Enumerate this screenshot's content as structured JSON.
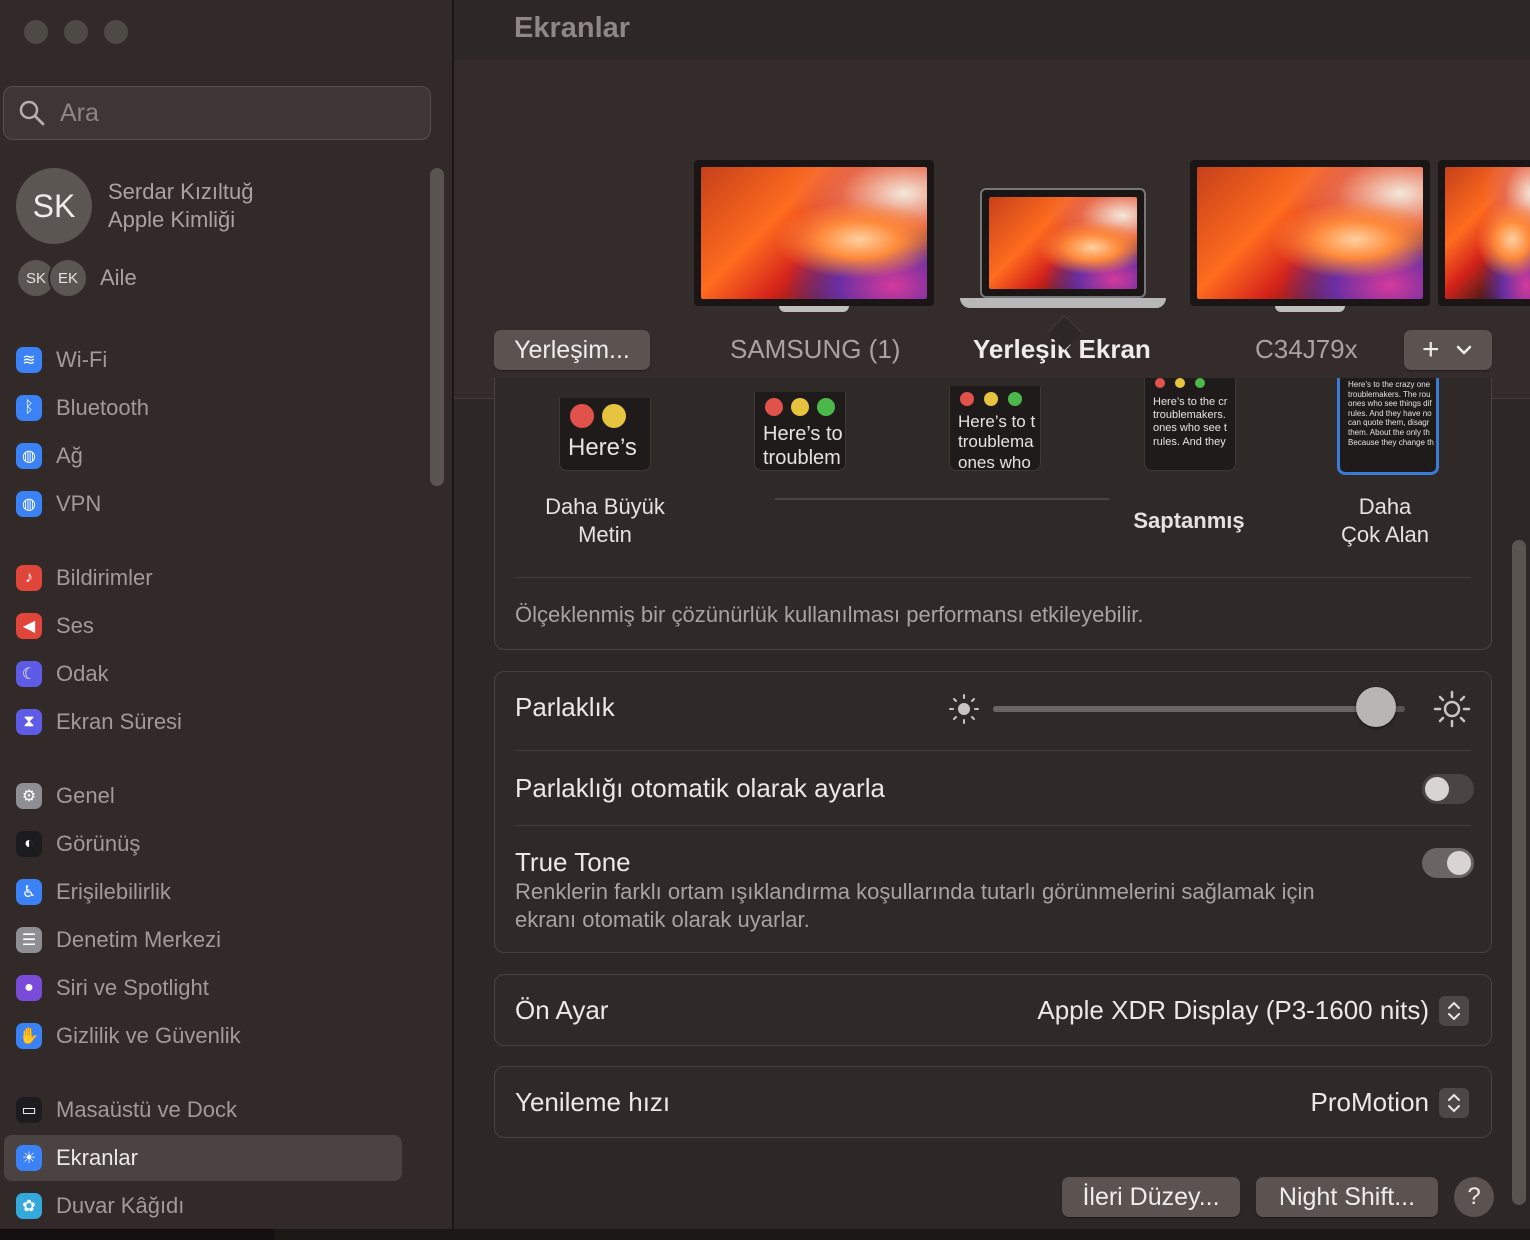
{
  "sidebar": {
    "search_placeholder": "Ara",
    "profile": {
      "initials": "SK",
      "name": "Serdar Kızıltuğ",
      "subtitle": "Apple Kimliği"
    },
    "family": {
      "members": [
        "SK",
        "EK"
      ],
      "label": "Aile"
    },
    "items": [
      {
        "label": "Wi-Fi",
        "icon": "wifi-icon",
        "color": "#3b82f6"
      },
      {
        "label": "Bluetooth",
        "icon": "bluetooth-icon",
        "color": "#3b82f6"
      },
      {
        "label": "Ağ",
        "icon": "globe-icon",
        "color": "#3b82f6"
      },
      {
        "label": "VPN",
        "icon": "vpn-globe-icon",
        "color": "#3b82f6"
      },
      {
        "label": "Bildirimler",
        "icon": "bell-icon",
        "color": "#e0453a"
      },
      {
        "label": "Ses",
        "icon": "speaker-icon",
        "color": "#e0453a"
      },
      {
        "label": "Odak",
        "icon": "moon-icon",
        "color": "#5e5ce6"
      },
      {
        "label": "Ekran Süresi",
        "icon": "hourglass-icon",
        "color": "#5e5ce6"
      },
      {
        "label": "Genel",
        "icon": "gear-icon",
        "color": "#8e8e93"
      },
      {
        "label": "Görünüş",
        "icon": "appearance-icon",
        "color": "#1c1c1e"
      },
      {
        "label": "Erişilebilirlik",
        "icon": "accessibility-icon",
        "color": "#3b82f6"
      },
      {
        "label": "Denetim Merkezi",
        "icon": "control-center-icon",
        "color": "#8e8e93"
      },
      {
        "label": "Siri ve Spotlight",
        "icon": "siri-icon",
        "color": "#7a4ad8"
      },
      {
        "label": "Gizlilik ve Güvenlik",
        "icon": "hand-icon",
        "color": "#3b82f6"
      },
      {
        "label": "Masaüstü ve Dock",
        "icon": "dock-icon",
        "color": "#1c1c1e"
      },
      {
        "label": "Ekranlar",
        "icon": "brightness-icon",
        "color": "#3b82f6",
        "active": true
      },
      {
        "label": "Duvar Kâğıdı",
        "icon": "wallpaper-icon",
        "color": "#34aadc"
      }
    ]
  },
  "main": {
    "title": "Ekranlar",
    "arrangement_button": "Yerleşim...",
    "displays": [
      {
        "label": "SAMSUNG (1)",
        "selected": false
      },
      {
        "label": "Yerleşik Ekran",
        "selected": true
      },
      {
        "label": "C34J79x",
        "selected": false
      }
    ],
    "add_button": "+",
    "resolution": {
      "thumbs": [
        {
          "text": "Here’s",
          "text2": ""
        },
        {
          "text": "Here’s to",
          "text2": "troublem"
        },
        {
          "text": "Here’s to t",
          "text2": "troublema",
          "text3": "ones who"
        },
        {
          "text": "Here’s to the cr",
          "text2": "troublemakers.",
          "text3": "ones who see t",
          "text4": "rules. And they"
        },
        {
          "text": "Here’s to the crazy one",
          "text2": "troublemakers. The rou",
          "text3": "ones who see things dif",
          "text4": "rules. And they have no",
          "text5": "can quote them, disagr",
          "text6": "them. About the only th",
          "text7": "Because they change th"
        }
      ],
      "label_larger": "Daha Büyük Metin",
      "label_larger_1": "Daha Büyük",
      "label_larger_2": "Metin",
      "label_default": "Saptanmış",
      "label_more_1": "Daha",
      "label_more_2": "Çok Alan",
      "note": "Ölçeklenmiş bir çözünürlük kullanılması performansı etkileyebilir."
    },
    "brightness": {
      "label": "Parlaklık",
      "value": 0.93,
      "auto_label": "Parlaklığı otomatik olarak ayarla",
      "auto_on": false,
      "true_tone_label": "True Tone",
      "true_tone_desc_1": "Renklerin farklı ortam ışıklandırma koşullarında tutarlı görünmelerini sağlamak için",
      "true_tone_desc_2": "ekranı otomatik olarak uyarlar.",
      "true_tone_on": true
    },
    "preset": {
      "label": "Ön Ayar",
      "value": "Apple XDR Display (P3-1600 nits)"
    },
    "refresh": {
      "label": "Yenileme hızı",
      "value": "ProMotion"
    },
    "buttons": {
      "advanced": "İleri Düzey...",
      "night_shift": "Night Shift...",
      "help": "?"
    }
  }
}
